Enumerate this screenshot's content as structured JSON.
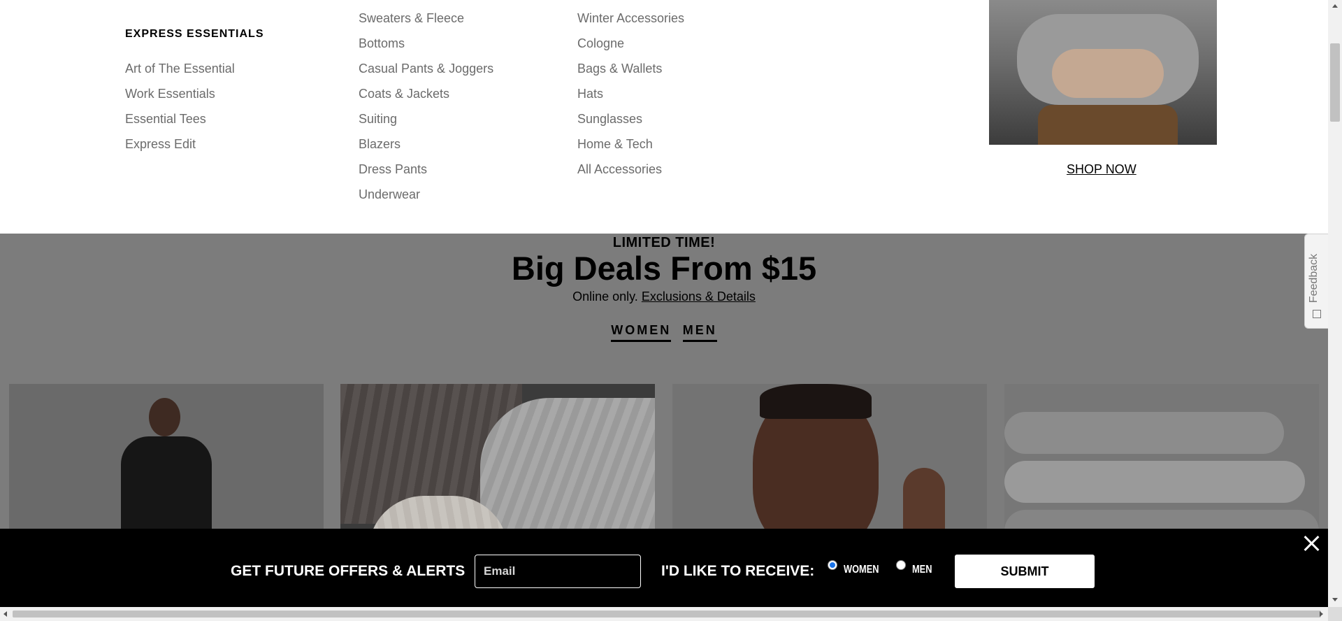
{
  "menu": {
    "col1": {
      "heading": "EXPRESS ESSENTIALS",
      "links": [
        "Art of The Essential",
        "Work Essentials",
        "Essential Tees",
        "Express Edit"
      ]
    },
    "col2": {
      "links": [
        "Sweaters & Fleece",
        "Bottoms",
        "Casual Pants & Joggers",
        "Coats & Jackets",
        "Suiting",
        "Blazers",
        "Dress Pants",
        "Underwear"
      ]
    },
    "col3": {
      "links": [
        "Winter Accessories",
        "Cologne",
        "Bags & Wallets",
        "Hats",
        "Sunglasses",
        "Home & Tech",
        "All Accessories"
      ]
    },
    "promo": {
      "image_desc": "man-in-grey-sweater-photo",
      "cta": "SHOP NOW"
    }
  },
  "deals": {
    "eyebrow": "LIMITED TIME!",
    "title": "Big Deals From $15",
    "subtitle_prefix": "Online only.",
    "subtitle_link": "Exclusions & Details",
    "tabs": [
      "WOMEN",
      "MEN"
    ]
  },
  "feedback": {
    "label": "Feedback"
  },
  "signup": {
    "headline": "GET FUTURE OFFERS & ALERTS",
    "email_placeholder": "Email",
    "receive_label": "I'D LIKE TO RECEIVE:",
    "options": [
      {
        "label": "WOMEN",
        "checked": true
      },
      {
        "label": "MEN",
        "checked": false
      }
    ],
    "submit": "SUBMIT"
  }
}
